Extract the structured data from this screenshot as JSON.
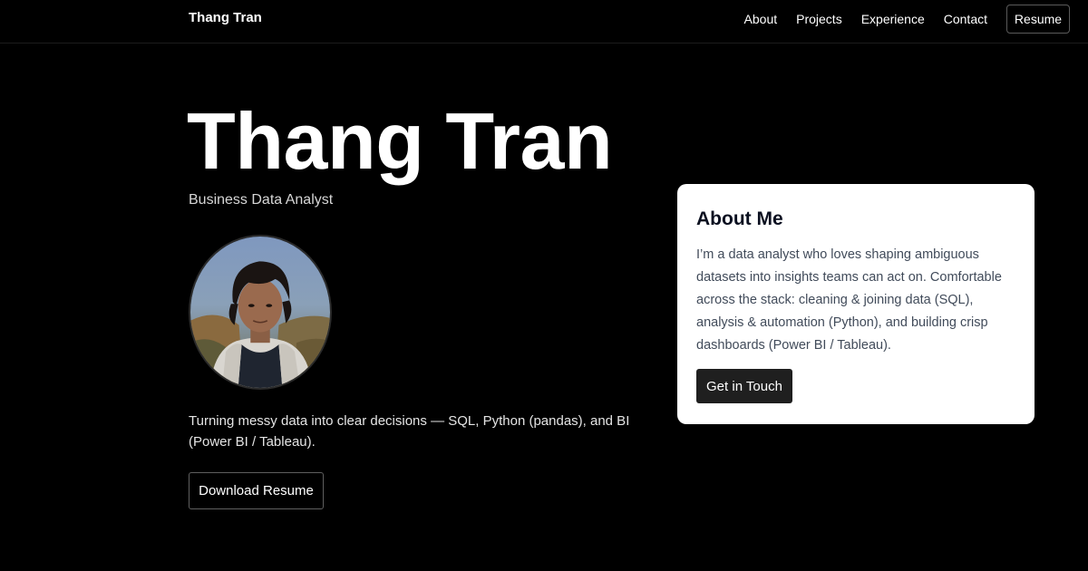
{
  "nav": {
    "brand": "Thang Tran",
    "links": [
      "About",
      "Projects",
      "Experience",
      "Contact"
    ],
    "resume_label": "Resume"
  },
  "hero": {
    "name": "Thang Tran",
    "role": "Business Data Analyst",
    "tagline": "Turning messy data into clear decisions — SQL, Python (pandas), and BI (Power BI / Tableau).",
    "download_label": "Download Resume"
  },
  "about": {
    "title": "About Me",
    "body": "I’m a data analyst who loves shaping ambiguous datasets into insights teams can act on. Comfortable across the stack: cleaning & joining data (SQL), analysis & automation (Python), and building crisp dashboards (Power BI / Tableau).",
    "cta_label": "Get in Touch"
  },
  "colors": {
    "background": "#000000",
    "card": "#ffffff",
    "card_button": "#1f1f1f",
    "card_text": "#414b5a"
  }
}
